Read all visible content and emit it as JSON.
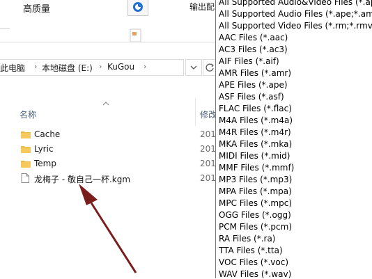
{
  "top": {
    "quality_label": "高质量",
    "output_label": "输出配"
  },
  "explorer": {
    "breadcrumb": [
      "此电脑",
      "本地磁盘 (E:)",
      "KuGou"
    ],
    "columns": {
      "name": "名称",
      "modified": "修改"
    },
    "rows": [
      {
        "type": "folder",
        "name": "Cache",
        "date": "201"
      },
      {
        "type": "folder",
        "name": "Lyric",
        "date": "201"
      },
      {
        "type": "folder",
        "name": "Temp",
        "date": "201"
      },
      {
        "type": "file",
        "name": "龙梅子 - 敬自己一杯.kgm",
        "date": "201"
      }
    ]
  },
  "filetype_dropdown": {
    "options": [
      "All Supported Audio&Video Files (*.ap",
      "All Supported Audio Files (*.ape;*.amr;",
      "All Supported Video Files (*.rm;*.rmvb;",
      "AAC Files (*.aac)",
      "AC3 Files (*.ac3)",
      "AIF Files (*.aif)",
      "AMR Files (*.amr)",
      "APE Files (*.ape)",
      "ASF Files (*.asf)",
      "FLAC Files (*.flac)",
      "M4A Files (*.m4a)",
      "M4R Files (*.m4r)",
      "MKA Files (*.mka)",
      "MIDI Files (*.mid)",
      "MMF Files (*.mmf)",
      "MP3 Files (*.mp3)",
      "MPA Files (*.mpa)",
      "MPC Files (*.mpc)",
      "OGG Files (*.ogg)",
      "PCM Files (*.pcm)",
      "RA Files (*.ra)",
      "TTA Files (*.tta)",
      "VOC Files (*.voc)",
      "WAV Files (*.wav)"
    ]
  },
  "colors": {
    "annotation_arrow": "#7a1d1d",
    "folder": "#e8b84a",
    "header_text": "#4c607a"
  }
}
